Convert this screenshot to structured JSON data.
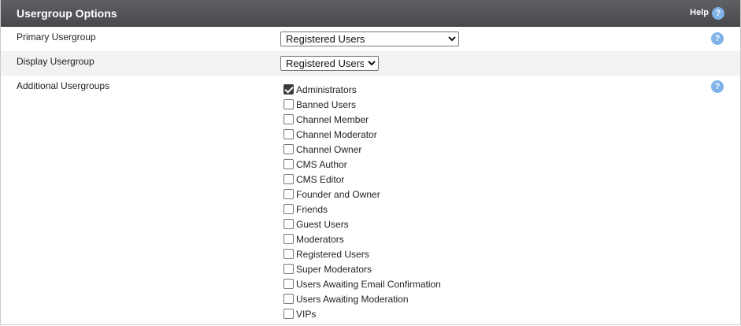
{
  "header": {
    "title": "Usergroup Options",
    "help_label": "Help",
    "help_icon": "?"
  },
  "primary": {
    "label": "Primary Usergroup",
    "selected": "Registered Users",
    "help_icon": "?"
  },
  "display": {
    "label": "Display Usergroup",
    "selected": "Registered Users"
  },
  "additional": {
    "label": "Additional Usergroups",
    "help_icon": "?",
    "items": [
      {
        "label": "Administrators",
        "checked": true
      },
      {
        "label": "Banned Users",
        "checked": false
      },
      {
        "label": "Channel Member",
        "checked": false
      },
      {
        "label": "Channel Moderator",
        "checked": false
      },
      {
        "label": "Channel Owner",
        "checked": false
      },
      {
        "label": "CMS Author",
        "checked": false
      },
      {
        "label": "CMS Editor",
        "checked": false
      },
      {
        "label": "Founder and Owner",
        "checked": false
      },
      {
        "label": "Friends",
        "checked": false
      },
      {
        "label": "Guest Users",
        "checked": false
      },
      {
        "label": "Moderators",
        "checked": false
      },
      {
        "label": "Registered Users",
        "checked": false
      },
      {
        "label": "Super Moderators",
        "checked": false
      },
      {
        "label": "Users Awaiting Email Confirmation",
        "checked": false
      },
      {
        "label": "Users Awaiting Moderation",
        "checked": false
      },
      {
        "label": "VIPs",
        "checked": false
      }
    ]
  },
  "colors": {
    "header_bg": "#4f5053",
    "help_badge": "#7fb2e8",
    "alt_row": "#f2f2f2"
  }
}
